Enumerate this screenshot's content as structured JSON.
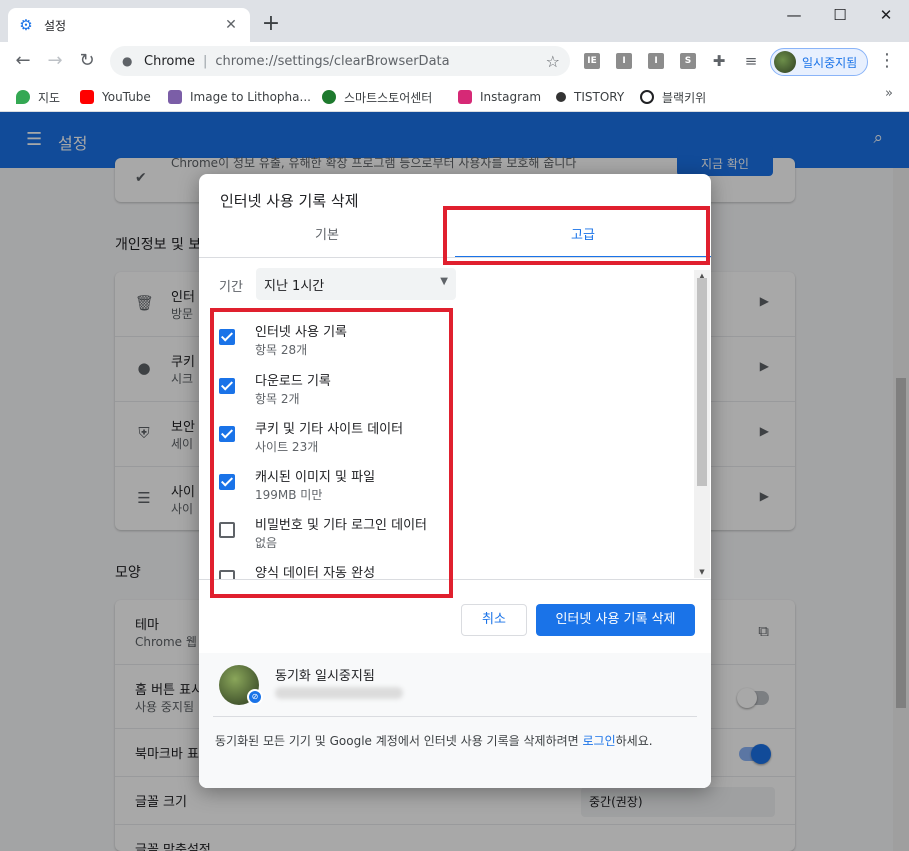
{
  "browser": {
    "tab_title": "설정",
    "tab_close": "✕",
    "new_tab": "+",
    "window": {
      "minimize": "—",
      "maximize": "☐",
      "close": "✕"
    },
    "omnibox": {
      "scheme": "Chrome",
      "url": "chrome://settings/clearBrowserData"
    },
    "extensions": [
      "IE",
      "I",
      "I",
      "S"
    ],
    "profile_label": "일시중지됨"
  },
  "bookmarks": [
    {
      "label": "지도",
      "color": "#34a853"
    },
    {
      "label": "YouTube",
      "color": "#ff0000"
    },
    {
      "label": "Image to Lithopha...",
      "color": "#7b5ea7"
    },
    {
      "label": "스마트스토어센터",
      "color": "#1e7a2e"
    },
    {
      "label": "Instagram",
      "color": "#d62976"
    },
    {
      "label": "TISTORY",
      "color": "#333333"
    },
    {
      "label": "블랙키위",
      "color": "#202124"
    }
  ],
  "settings": {
    "title": "설정",
    "privacy_section": "개인정보 및 보",
    "privacy_rows": [
      {
        "icon": "trash-icon",
        "title": "인터",
        "sub": "방문"
      },
      {
        "icon": "cookie-icon",
        "title": "쿠키",
        "sub": "시크"
      },
      {
        "icon": "shield-icon",
        "title": "보안",
        "sub": "세이"
      },
      {
        "icon": "sliders-icon",
        "title": "사이",
        "sub": "사이"
      }
    ],
    "top_card_text": "Chrome이 정보 유출, 유해한 확장 프로그램 등으로부터 사용자를 보호해 줍니다",
    "top_card_button": "지금 확인",
    "appearance_section": "모양",
    "appearance_rows": [
      {
        "title": "테마",
        "sub": "Chrome 웹"
      },
      {
        "title": "홈 버튼 표시",
        "sub": "사용 중지됨"
      },
      {
        "title": "북마크바 표",
        "sub": ""
      },
      {
        "title": "글꼴 크기",
        "sub": "",
        "value": "중간(권장)"
      },
      {
        "title": "글꼴 맞춤설정",
        "sub": ""
      }
    ]
  },
  "dialog": {
    "title": "인터넷 사용 기록 삭제",
    "tabs": [
      {
        "label": "기본",
        "active": false
      },
      {
        "label": "고급",
        "active": true
      }
    ],
    "period_label": "기간",
    "period_value": "지난 1시간",
    "items": [
      {
        "title": "인터넷 사용 기록",
        "sub": "항목 28개",
        "checked": true
      },
      {
        "title": "다운로드 기록",
        "sub": "항목 2개",
        "checked": true
      },
      {
        "title": "쿠키 및 기타 사이트 데이터",
        "sub": "사이트 23개",
        "checked": true
      },
      {
        "title": "캐시된 이미지 및 파일",
        "sub": "199MB 미만",
        "checked": true
      },
      {
        "title": "비밀번호 및 기타 로그인 데이터",
        "sub": "없음",
        "checked": false
      },
      {
        "title": "양식 데이터 자동 완성",
        "sub": "",
        "checked": false
      }
    ],
    "cancel_label": "취소",
    "clear_label": "인터넷 사용 기록 삭제",
    "sync_name": "동기화 일시중지됨",
    "footer_text_before": "동기화된 모든 기기 및 Google 계정에서 인터넷 사용 기록을 삭제하려면 ",
    "footer_link": "로그인",
    "footer_text_after": "하세요.",
    "highlight_color": "#e0202e"
  }
}
